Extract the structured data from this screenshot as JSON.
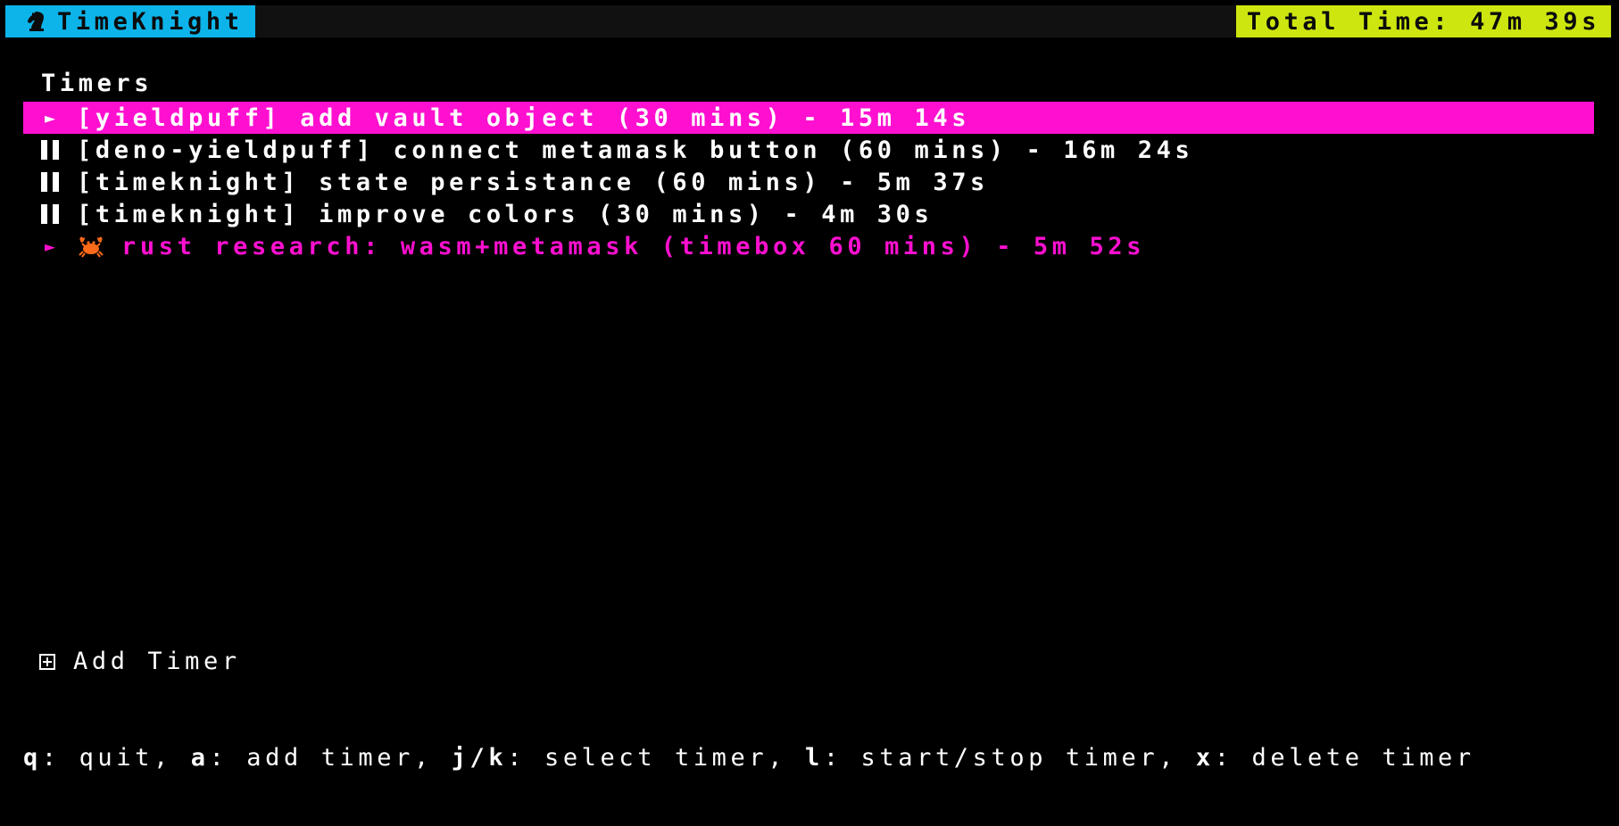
{
  "app": {
    "name": "TimeKnight",
    "brand_color": "#0db4ea",
    "icon": "chess-knight-icon"
  },
  "header": {
    "total_time": "Total Time: 47m 39s",
    "total_color": "#cde60f"
  },
  "timers": {
    "title": "Timers",
    "accent_color": "#ff10d0",
    "items": [
      {
        "status": "running",
        "status_icon": "play-icon",
        "label": "[yieldpuff] add vault object (30 mins) - 15m 14s",
        "selected": true
      },
      {
        "status": "paused",
        "status_icon": "pause-icon",
        "label": "[deno-yieldpuff] connect metamask button (60 mins) - 16m 24s",
        "selected": false
      },
      {
        "status": "paused",
        "status_icon": "pause-icon",
        "label": "[timeknight] state persistance (60 mins) - 5m 37s",
        "selected": false
      },
      {
        "status": "paused",
        "status_icon": "pause-icon",
        "label": "[timeknight] improve colors (30 mins) - 4m 30s",
        "selected": false
      },
      {
        "status": "running",
        "status_icon": "play-icon",
        "prefix_icon": "crab-icon",
        "label": "rust research: wasm+metamask (timebox 60 mins) - 5m 52s",
        "selected": false
      }
    ]
  },
  "add_timer": {
    "icon": "plus-box-icon",
    "label": "Add Timer"
  },
  "help": {
    "items": [
      {
        "key": "q",
        "desc": ": quit, "
      },
      {
        "key": "a",
        "desc": ": add timer, "
      },
      {
        "key": "j/k",
        "desc": ": select timer, "
      },
      {
        "key": "l",
        "desc": ": start/stop timer, "
      },
      {
        "key": "x",
        "desc": ": delete timer"
      }
    ]
  }
}
